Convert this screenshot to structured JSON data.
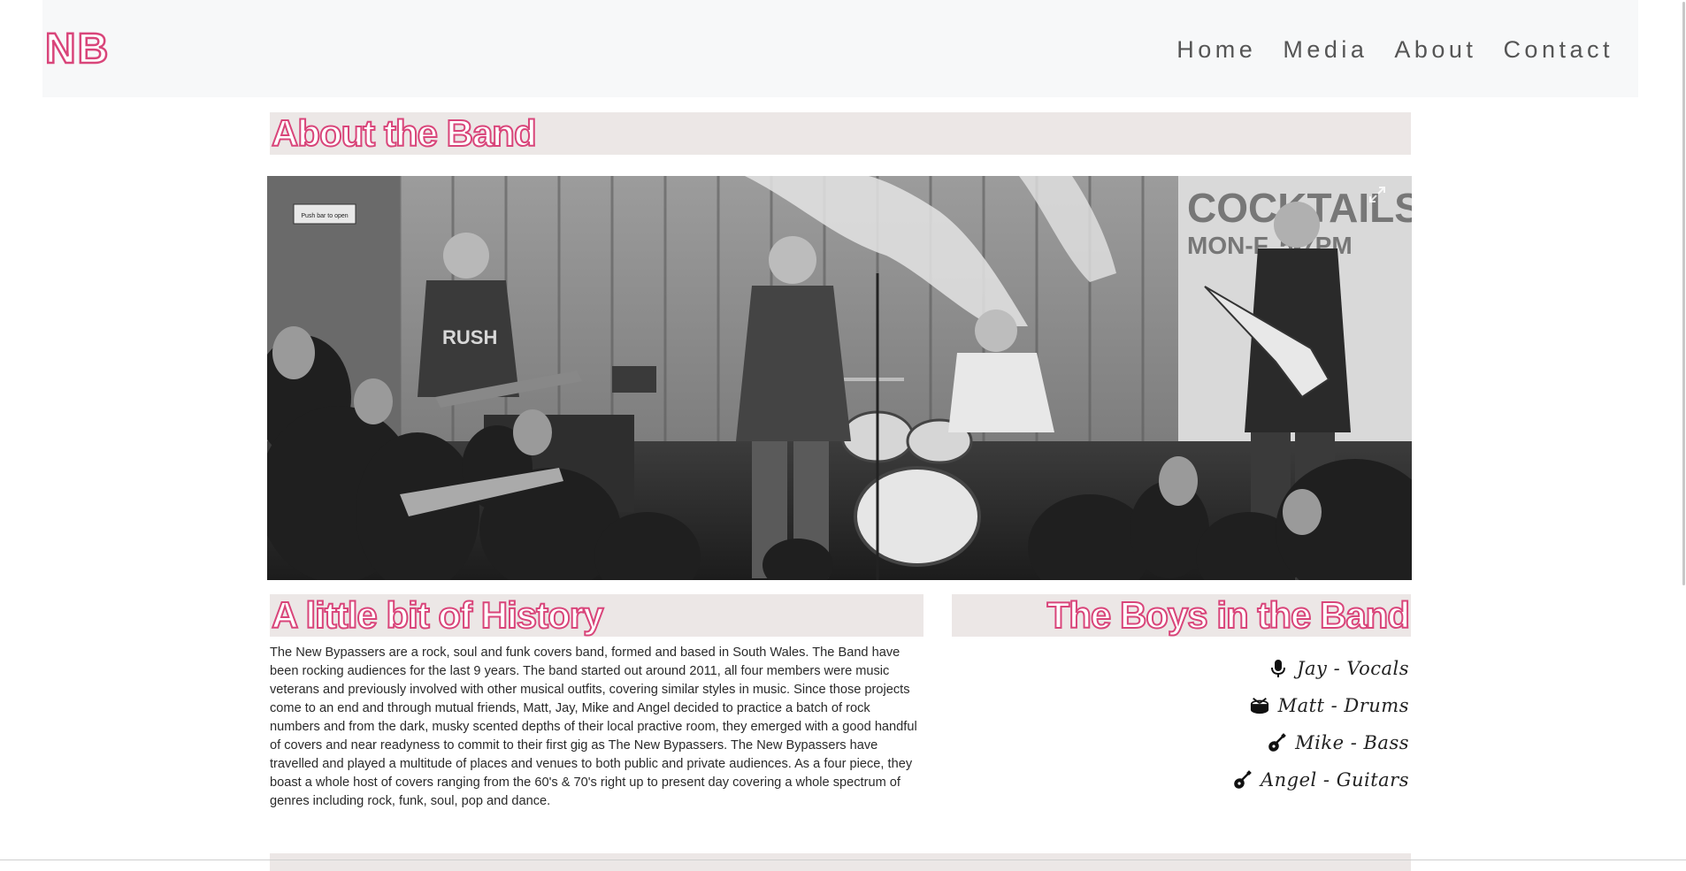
{
  "nav": {
    "brand": "NB",
    "links": [
      "Home",
      "Media",
      "About",
      "Contact"
    ]
  },
  "about": {
    "title": "About the Band"
  },
  "hero": {
    "poster_line1": "COCKTAILS",
    "poster_line2": "MON-F. 5-7PM",
    "shirt_text": "RUSH",
    "sign_text": "Push bar to open"
  },
  "history": {
    "title": "A little bit of History",
    "text": "The New Bypassers are a rock, soul and funk covers band, formed and based in South Wales. The Band have been rocking audiences for the last 9 years. The band started out around 2011, all four members were music veterans and previously involved with other musical outfits, covering similar styles in music. Since those projects come to an end and through mutual friends, Matt, Jay, Mike and Angel decided to practice a batch of rock numbers and from the dark, musky scented depths of their local practive room, they emerged with a good handful of covers and near readyness to commit to their first gig as The New Bypassers. The New Bypassers have travelled and played a multitude of places and venues to both public and private audiences. As a four piece, they boast a whole host of covers ranging from the 60's & 70's right up to present day covering a whole spectrum of genres including rock, funk, soul, pop and dance."
  },
  "band": {
    "title": "The Boys in the Band",
    "members": [
      {
        "label": "Jay - Vocals",
        "icon": "microphone-icon"
      },
      {
        "label": "Matt - Drums",
        "icon": "drum-icon"
      },
      {
        "label": "Mike - Bass",
        "icon": "guitar-icon"
      },
      {
        "label": "Angel - Guitars",
        "icon": "guitar-icon"
      }
    ]
  },
  "colors": {
    "accent": "#d9457a",
    "header_bg": "#ece7e6",
    "navbar_bg": "#f7f8f9"
  }
}
